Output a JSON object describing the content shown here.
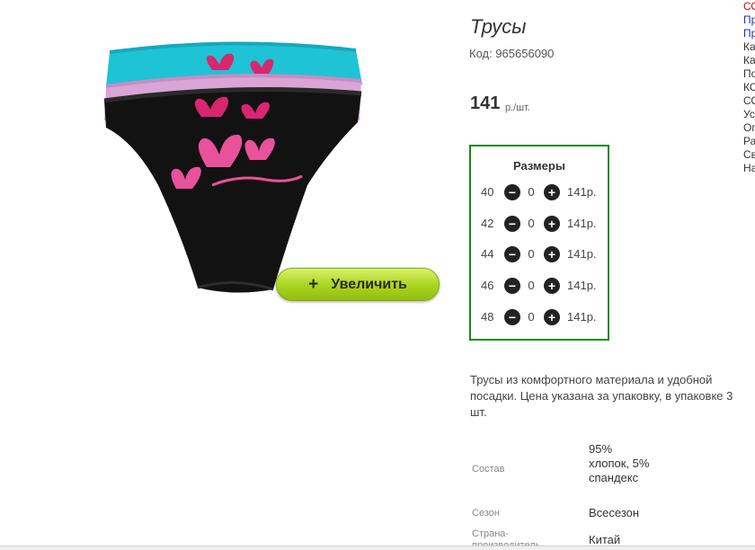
{
  "product": {
    "title": "Трусы",
    "code": "Код: 965656090",
    "price": "141",
    "price_unit": "р./шт.",
    "zoom_button": "Увеличить",
    "zoom_plus": "+"
  },
  "sizes": {
    "title": "Размеры",
    "rows": [
      {
        "size": "40",
        "qty": "0",
        "price": "141р."
      },
      {
        "size": "42",
        "qty": "0",
        "price": "141р."
      },
      {
        "size": "44",
        "qty": "0",
        "price": "141р."
      },
      {
        "size": "46",
        "qty": "0",
        "price": "141р."
      },
      {
        "size": "48",
        "qty": "0",
        "price": "141р."
      }
    ]
  },
  "description": "Трусы из комфортного материала и удобной посадки. Цена указана за упаковку, в упаковке 3 шт.",
  "specs": [
    {
      "label": "Состав",
      "value": "95% хлопок, 5% спандекс"
    },
    {
      "label": "Сезон",
      "value": "Всесезон"
    },
    {
      "label": "Страна-производитель",
      "value": "Китай"
    }
  ],
  "right_nav": [
    "СО",
    "Пр",
    "Пр",
    "Ка",
    "Ка",
    "По",
    "КС",
    "СО",
    "Ус",
    "Оп",
    "Ра",
    "Св",
    "На"
  ],
  "colors": {
    "sizes_border": "#178a17",
    "zoom_button": "#a9d31d",
    "nav_red": "#dd0000",
    "nav_blue": "#1a2fbf"
  }
}
